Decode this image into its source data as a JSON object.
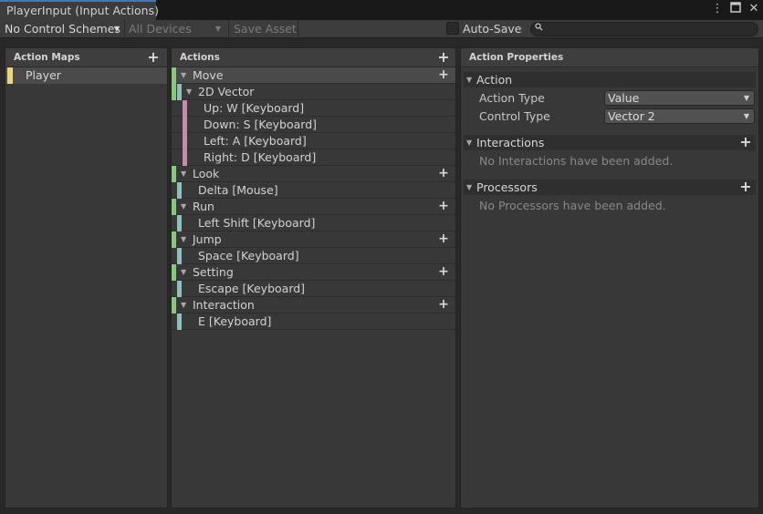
{
  "tab": {
    "title": "PlayerInput (Input Actions)"
  },
  "toolbar": {
    "control_schemes": "No Control Schemes",
    "devices": "All Devices",
    "save_asset": "Save Asset",
    "auto_save": "Auto-Save",
    "search": {
      "value": "",
      "icon": "search-icon"
    }
  },
  "action_maps": {
    "header": "Action Maps",
    "items": [
      {
        "label": "Player",
        "color": "#e9d67c"
      }
    ]
  },
  "actions": {
    "header": "Actions",
    "rows": [
      {
        "label": "Move",
        "kind": "action"
      },
      {
        "label": "2D Vector",
        "kind": "composite"
      },
      {
        "label": "Up: W [Keyboard]",
        "kind": "part"
      },
      {
        "label": "Down: S [Keyboard]",
        "kind": "part"
      },
      {
        "label": "Left: A [Keyboard]",
        "kind": "part"
      },
      {
        "label": "Right: D [Keyboard]",
        "kind": "part"
      },
      {
        "label": "Look",
        "kind": "action"
      },
      {
        "label": "Delta [Mouse]",
        "kind": "binding"
      },
      {
        "label": "Run",
        "kind": "action"
      },
      {
        "label": "Left Shift [Keyboard]",
        "kind": "binding"
      },
      {
        "label": "Jump",
        "kind": "action"
      },
      {
        "label": "Space [Keyboard]",
        "kind": "binding"
      },
      {
        "label": "Setting",
        "kind": "action"
      },
      {
        "label": "Escape [Keyboard]",
        "kind": "binding"
      },
      {
        "label": "Interaction",
        "kind": "action"
      },
      {
        "label": "E [Keyboard]",
        "kind": "binding"
      }
    ],
    "colors": {
      "action": "#8ac77e",
      "binding": "#8ebfbd",
      "part": "#c88aa8"
    }
  },
  "properties": {
    "header": "Action Properties",
    "action_section": "Action",
    "action_type_label": "Action Type",
    "action_type_value": "Value",
    "control_type_label": "Control Type",
    "control_type_value": "Vector 2",
    "interactions_section": "Interactions",
    "interactions_empty": "No Interactions have been added.",
    "processors_section": "Processors",
    "processors_empty": "No Processors have been added."
  }
}
